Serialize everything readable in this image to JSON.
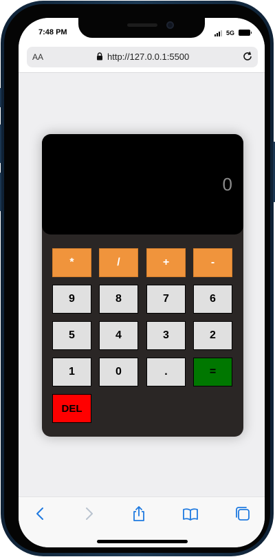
{
  "status_bar": {
    "time": "7:48 PM",
    "network": "5G"
  },
  "browser": {
    "text_size_label": "AA",
    "url": "http://127.0.0.1:5500"
  },
  "calculator": {
    "display_value": "0",
    "operator_keys": [
      "*",
      "/",
      "+",
      "-"
    ],
    "number_rows": [
      [
        "9",
        "8",
        "7",
        "6"
      ],
      [
        "5",
        "4",
        "3",
        "2"
      ],
      [
        "1",
        "0",
        "."
      ]
    ],
    "equals_label": "=",
    "delete_label": "DEL",
    "colors": {
      "operator": "#f0943c",
      "number": "#e0e0e0",
      "equals": "#007700",
      "delete": "#ff0000",
      "body": "#2a2625",
      "display": "#000000"
    }
  },
  "toolbar": {
    "icons": [
      "back-icon",
      "forward-icon",
      "share-icon",
      "bookmarks-icon",
      "tabs-icon"
    ]
  }
}
